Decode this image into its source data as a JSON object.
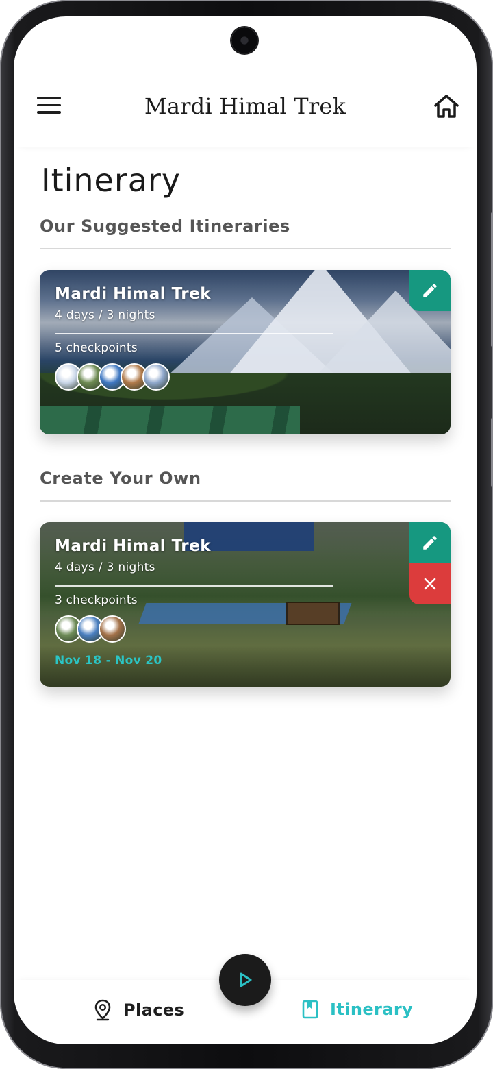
{
  "header": {
    "title": "Mardi Himal Trek"
  },
  "page": {
    "title": "Itinerary"
  },
  "sections": {
    "suggested": {
      "title": "Our Suggested Itineraries"
    },
    "own": {
      "title": "Create Your Own"
    }
  },
  "cards": [
    {
      "title": "Mardi Himal Trek",
      "duration": "4 days / 3 nights",
      "checkpoints": "5 checkpoints",
      "avatar_colors": [
        "#c9d6e8",
        "#6d8a52",
        "#3f78c2",
        "#b07a4a",
        "#8fa8cc"
      ]
    },
    {
      "title": "Mardi Himal Trek",
      "duration": "4 days / 3 nights",
      "checkpoints": "3 checkpoints",
      "avatar_colors": [
        "#6e8c58",
        "#4a7fc0",
        "#a4724a"
      ],
      "dates": "Nov 18 - Nov 20"
    }
  ],
  "bottom_nav": {
    "places_label": "Places",
    "itinerary_label": "Itinerary"
  },
  "colors": {
    "accent_teal": "#2bc0c4",
    "edit_green": "#169880",
    "delete_red": "#dc3c3c"
  },
  "icons": [
    "hamburger-icon",
    "home-icon",
    "edit-icon",
    "close-icon",
    "map-pin-icon",
    "bookmark-icon",
    "play-icon"
  ]
}
